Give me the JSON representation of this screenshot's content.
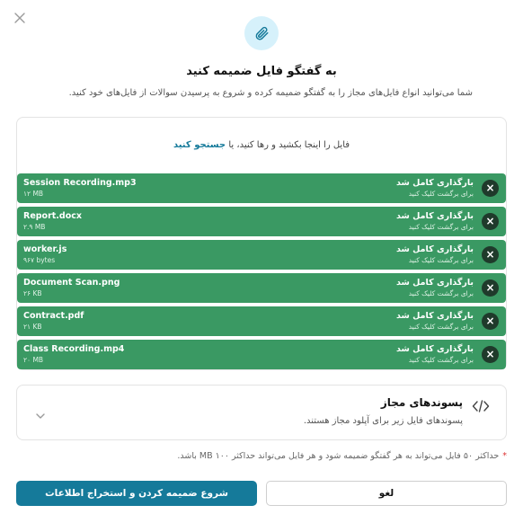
{
  "dialog": {
    "title": "به گفتگو فایل ضمیمه کنید",
    "subtitle": "شما می‌توانید انواع فایل‌های مجاز را به گفتگو ضمیمه کرده و شروع به پرسیدن سوالات از فایل‌های خود کنید."
  },
  "icons": {
    "close": "close-icon",
    "hero": "paperclip-icon",
    "extensions": "code-icon",
    "chevron": "chevron-down-icon"
  },
  "dropzone": {
    "prompt": "فایل را اینجا بکشید و رها کنید، یا",
    "link": "جستجو کنید"
  },
  "files": [
    {
      "name": "Session Recording.mp3",
      "size": "۱۲ MB",
      "status": "بارگذاری کامل شد",
      "hint": "برای برگشت کلیک کنید"
    },
    {
      "name": "Report.docx",
      "size": "۲.۹ MB",
      "status": "بارگذاری کامل شد",
      "hint": "برای برگشت کلیک کنید"
    },
    {
      "name": "worker.js",
      "size": "۹۶۷ bytes",
      "status": "بارگذاری کامل شد",
      "hint": "برای برگشت کلیک کنید"
    },
    {
      "name": "Document Scan.png",
      "size": "۲۶ KB",
      "status": "بارگذاری کامل شد",
      "hint": "برای برگشت کلیک کنید"
    },
    {
      "name": "Contract.pdf",
      "size": "۲۱ KB",
      "status": "بارگذاری کامل شد",
      "hint": "برای برگشت کلیک کنید"
    },
    {
      "name": "Class Recording.mp4",
      "size": "۲۰ MB",
      "status": "بارگذاری کامل شد",
      "hint": "برای برگشت کلیک کنید"
    }
  ],
  "extensions": {
    "title": "پسوندهای مجاز",
    "description": "پسوندهای فایل زیر برای آپلود مجاز هستند."
  },
  "note": {
    "star": "*",
    "text": "حداکثر ۵۰ فایل می‌تواند به هر گفتگو ضمیمه شود و هر فایل می‌تواند حداکثر ۱۰۰ MB باشد."
  },
  "buttons": {
    "primary": "شروع ضمیمه کردن و استخراج اطلاعات",
    "secondary": "لغو"
  },
  "colors": {
    "accent": "#157a9a",
    "success": "#3a9963",
    "hero_bg": "#d6f1fb"
  }
}
